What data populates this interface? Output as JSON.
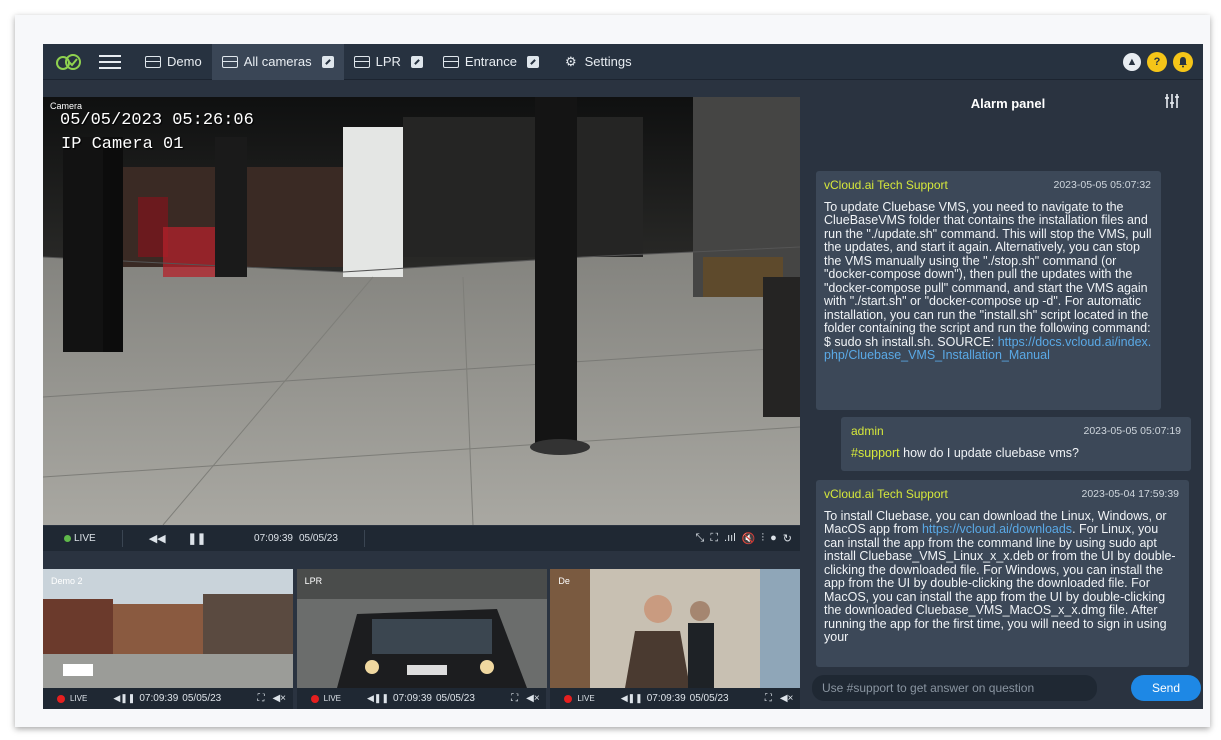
{
  "topbar": {
    "tabs": [
      {
        "label": "Demo",
        "editable": false
      },
      {
        "label": "All cameras",
        "editable": true
      },
      {
        "label": "LPR",
        "editable": true
      },
      {
        "label": "Entrance",
        "editable": true
      }
    ],
    "settings_label": "Settings",
    "help_glyph": "?"
  },
  "main_video": {
    "camera_label": "Camera",
    "osd_datetime": "05/05/2023 05:26:06",
    "osd_camera_name": "IP Camera 01",
    "controls": {
      "live_label": "LIVE",
      "time": "07:09:39",
      "date": "05/05/23"
    }
  },
  "thumbnails": [
    {
      "label": "Demo 2",
      "live_label": "LIVE",
      "time": "07:09:39",
      "date": "05/05/23"
    },
    {
      "label": "LPR",
      "live_label": "LIVE",
      "time": "07:09:39",
      "date": "05/05/23"
    },
    {
      "label": "De",
      "live_label": "LIVE",
      "time": "07:09:39",
      "date": "05/05/23"
    }
  ],
  "alarm_panel": {
    "title": "Alarm panel",
    "messages": [
      {
        "sender": "vCloud.ai Tech Support",
        "timestamp": "2023-05-05 05:07:32",
        "text": "To update Cluebase VMS, you need to navigate to the ClueBaseVMS folder that contains the installation files and run the \"./update.sh\" command. This will stop the VMS, pull the updates, and start it again. Alternatively, you can stop the VMS manually using the \"./stop.sh\" command (or \"docker-compose down\"), then pull the updates with the \"docker-compose pull\" command, and start the VMS again with \"./start.sh\" or \"docker-compose up -d\". For automatic installation, you can run the \"install.sh\" script located in the folder containing the script and run the following command: $ sudo sh install.sh. SOURCE:",
        "link": "https://docs.vcloud.ai/index.php/Cluebase_VMS_Installation_Manual"
      },
      {
        "sender": "admin",
        "timestamp": "2023-05-05 05:07:19",
        "tag": "#support",
        "text": " how do I update cluebase vms?"
      },
      {
        "sender": "vCloud.ai Tech Support",
        "timestamp": "2023-05-04 17:59:39",
        "text_before": "To install Cluebase, you can download the Linux, Windows, or MacOS app from",
        "link": "https://vcloud.ai/downloads",
        "text_after": ". For Linux, you can install the app from the command line by using sudo apt install Cluebase_VMS_Linux_x_x.deb or from the UI by double-clicking the downloaded file. For Windows, you can install the app from the UI by double-clicking the downloaded file. For MacOS, you can install the app from the UI by double-clicking the downloaded Cluebase_VMS_MacOS_x_x.dmg file. After running the app for the first time, you will need to sign in using your"
      }
    ],
    "input_placeholder": "Use #support to get answer on question",
    "send_label": "Send"
  },
  "colors": {
    "app_bg": "#2a3340",
    "accent_green": "#5fb94a",
    "accent_yellow": "#d6e83b",
    "send_blue": "#1e88e5",
    "live_red": "#e51f1f"
  }
}
